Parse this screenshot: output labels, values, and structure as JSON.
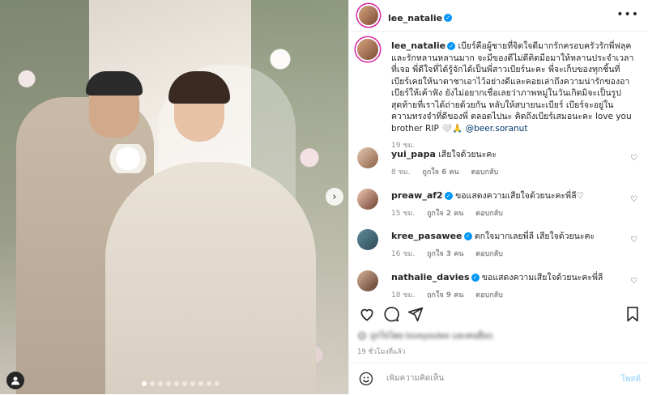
{
  "post": {
    "author": "lee_natalie",
    "header_more": "•••"
  },
  "caption": {
    "username": "lee_natalie",
    "text": "เบียร์คือผู้ชายที่จิตใจดีมากรักครอบครัวรักพี่ฟลุคและรักหลานหลานมาก จะมีของดีไม่ดีติดมือมาให้หลานประจำเวลาที่เจอ พี่ดีใจที่ได้รู้จักได้เป็นพี่สาวเบียร์นะคะ พี่จะเก็บของทุกชิ้นที่เบียร์เคยให้นาตาชาเอาไว้อย่างดีและคอยเล่าถึงความน่ารักของอาเบียร์ให้เค้าฟัง ยังไม่อยากเชื่อเลยว่าภาพหมู่ในวันเกิดมิจะเป็นรูปสุดท้ายที่เราได้ถ่ายด้วยกัน หลับให้สบายนะเบียร์ เบียร์จะอยู่ในความทรงจำที่ดีของพี่ ตลอดไปนะ คิดถึงเบียร์เสมอนะคะ love you brother RIP 🤍🙏 ",
    "mention": "@beer.soranut",
    "time": "19 ชม."
  },
  "comments": [
    {
      "username": "yui_papa",
      "verified": false,
      "text": "เสียใจด้วยนะคะ",
      "time": "8 ชม.",
      "likes": "ถูกใจ 6 คน",
      "reply": "ตอบกลับ"
    },
    {
      "username": "preaw_af2",
      "verified": true,
      "text": "ขอแสดงความเสียใจด้วยนะคะพี่ลี♡",
      "time": "15 ชม.",
      "likes": "ถูกใจ 2 คน",
      "reply": "ตอบกลับ"
    },
    {
      "username": "kree_pasawee",
      "verified": true,
      "text": "ตกใจมากเลยพี่ลี เสียใจด้วยนะคะ",
      "time": "16 ชม.",
      "likes": "ถูกใจ 3 คน",
      "reply": "ตอบกลับ"
    },
    {
      "username": "nathalie_davies",
      "verified": true,
      "text": "ขอแสดงความเสียใจด้วยนะคะพี่ลี",
      "time": "18 ชม.",
      "likes": "ถูกใจ 9 คน",
      "reply": "ตอบกลับ"
    }
  ],
  "likes_line": "ถูกใจโดย loveyoulee และคนอื่นๆ",
  "time_ago": "19 ชั่วโมงที่แล้ว",
  "add_comment": {
    "placeholder": "เพิ่มความคิดเห็น",
    "post_label": "โพสต์"
  },
  "icons": {
    "like": "heart-icon",
    "comment": "comment-icon",
    "share": "share-icon",
    "save": "bookmark-icon",
    "emoji": "emoji-icon",
    "next": "chevron-right-icon",
    "tag": "user-tag-icon"
  },
  "colors": {
    "verified": "#0095f6",
    "story_ring": "#d6249f",
    "mention": "#00376b",
    "post_button_disabled": "#b2dffc"
  },
  "carousel": {
    "total_slides": 10,
    "active_slide": 1
  }
}
